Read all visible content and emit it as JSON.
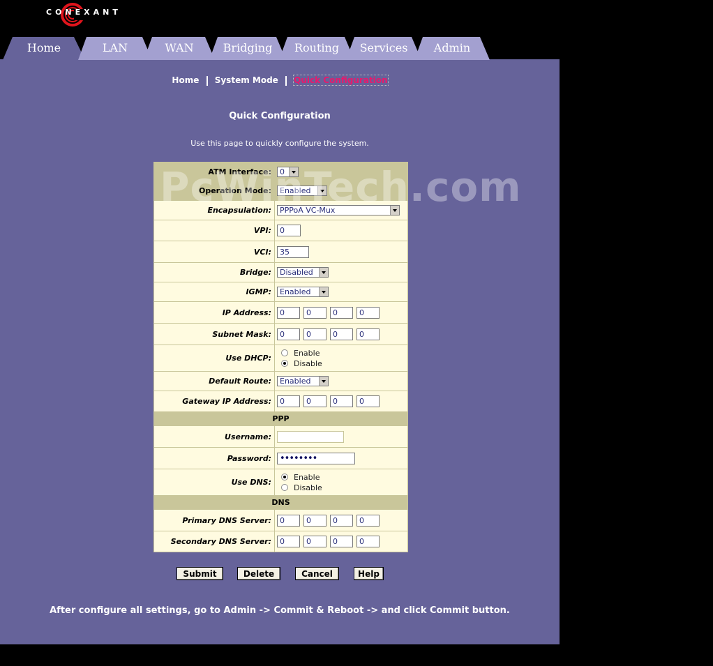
{
  "brand": {
    "name": "CONEXANT"
  },
  "tabs": [
    {
      "label": "Home",
      "active": true
    },
    {
      "label": "LAN"
    },
    {
      "label": "WAN"
    },
    {
      "label": "Bridging"
    },
    {
      "label": "Routing"
    },
    {
      "label": "Services"
    },
    {
      "label": "Admin"
    }
  ],
  "breadcrumb": {
    "home": "Home",
    "system_mode": "System Mode",
    "current": "Quick Configuration"
  },
  "page": {
    "title": "Quick Configuration",
    "description": "Use this page to quickly configure the system."
  },
  "form": {
    "atm_interface": {
      "label": "ATM Interface:",
      "value": "0"
    },
    "operation_mode": {
      "label": "Operation Mode:",
      "value": "Enabled"
    },
    "encapsulation": {
      "label": "Encapsulation:",
      "value": "PPPoA VC-Mux"
    },
    "vpi": {
      "label": "VPI:",
      "value": "0"
    },
    "vci": {
      "label": "VCI:",
      "value": "35"
    },
    "bridge": {
      "label": "Bridge:",
      "value": "Disabled"
    },
    "igmp": {
      "label": "IGMP:",
      "value": "Enabled"
    },
    "ip_address": {
      "label": "IP Address:",
      "octets": [
        "0",
        "0",
        "0",
        "0"
      ]
    },
    "subnet_mask": {
      "label": "Subnet Mask:",
      "octets": [
        "0",
        "0",
        "0",
        "0"
      ]
    },
    "use_dhcp": {
      "label": "Use DHCP:",
      "options": [
        "Enable",
        "Disable"
      ],
      "selected": "Disable"
    },
    "default_route": {
      "label": "Default Route:",
      "value": "Enabled"
    },
    "gateway_ip": {
      "label": "Gateway IP Address:",
      "octets": [
        "0",
        "0",
        "0",
        "0"
      ]
    },
    "ppp_section": "PPP",
    "username": {
      "label": "Username:",
      "value": ""
    },
    "password": {
      "label": "Password:",
      "value": "••••••••"
    },
    "use_dns": {
      "label": "Use DNS:",
      "options": [
        "Enable",
        "Disable"
      ],
      "selected": "Enable"
    },
    "dns_section": "DNS",
    "primary_dns": {
      "label": "Primary DNS Server:",
      "octets": [
        "0",
        "0",
        "0",
        "0"
      ]
    },
    "secondary_dns": {
      "label": "Secondary DNS Server:",
      "octets": [
        "0",
        "0",
        "0",
        "0"
      ]
    }
  },
  "buttons": {
    "submit": "Submit",
    "delete": "Delete",
    "cancel": "Cancel",
    "help": "Help"
  },
  "footnote": "After configure all settings, go to Admin -> Commit & Reboot -> and click Commit button.",
  "watermark": "PcWinTech.com",
  "colors": {
    "panel": "#66639a",
    "tab_active": "#66639a",
    "tab_inactive": "#a3a0d0",
    "form_bg": "#fffbe0",
    "accent_link": "#e8196c"
  }
}
